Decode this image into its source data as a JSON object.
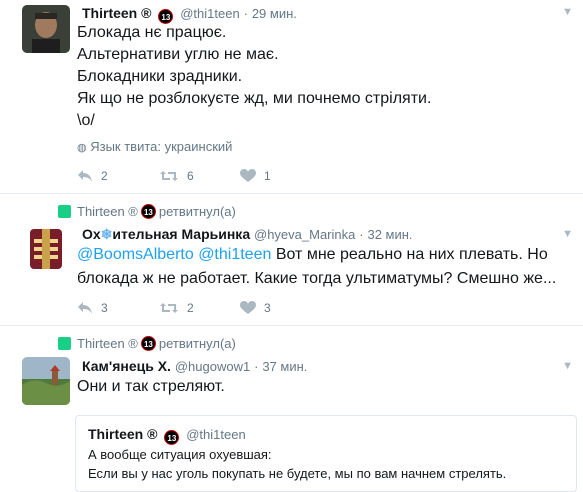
{
  "tweet1": {
    "name": "Thirteen ®",
    "badge": "13",
    "handle": "@thi1teen",
    "time": "29 мин.",
    "lines": [
      "Блокада нє працює.",
      "Альтернативи углю не має.",
      "Блокадники зрадники.",
      "Як що не розблокуєте жд, ми почнемо стріляти.",
      "\\o/"
    ],
    "lang": "Язык твита: украинский",
    "replies": "2",
    "retweets": "6",
    "likes": "1"
  },
  "tweet2": {
    "retweeter": "Thirteen ®",
    "badge": "13",
    "retweeted_label": "ретвитнул(а)",
    "name_part1": "Ох",
    "name_snow": "❄",
    "name_part2": "ительная Марьинка",
    "handle": "@hyeva_Marinka",
    "time": "32 мин.",
    "mention1": "@BoomsAlberto",
    "mention2": "@thi1teen",
    "text1": "Вот мне реально на них плевать. Но",
    "text2": "блокада ж не работает. Какие тогда ультиматумы? Смешно же...",
    "replies": "3",
    "retweets": "2",
    "likes": "3"
  },
  "tweet3": {
    "retweeter": "Thirteen ®",
    "badge": "13",
    "retweeted_label": "ретвитнул(а)",
    "name": "Кам'янець Х.",
    "handle": "@hugowow1",
    "time": "37 мин.",
    "text": "Они и так стреляют.",
    "quote": {
      "name": "Thirteen ®",
      "badge": "13",
      "handle": "@thi1teen",
      "line1": "А вообще ситуация охуевшая:",
      "line2": "Если вы у нас уголь покупать не будете, мы по вам начнем стрелять."
    }
  },
  "separator": "·",
  "colors": {
    "link": "#1da1f2",
    "retweet_green": "#19cf86",
    "muted": "#657786",
    "icon": "#aab8c2"
  }
}
